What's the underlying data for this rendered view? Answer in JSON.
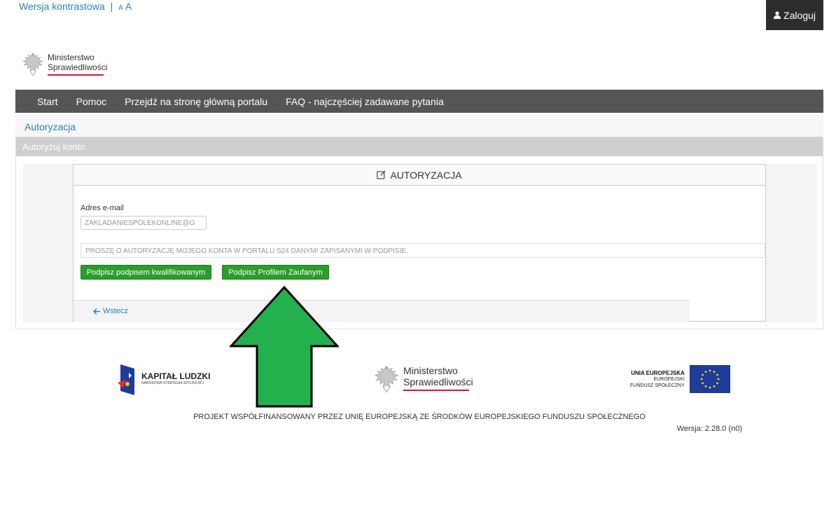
{
  "topbar": {
    "contrast_link": "Wersja kontrastowa",
    "separator": "|",
    "font_small": "A",
    "font_big": "A"
  },
  "header": {
    "login_label": "Zaloguj",
    "login_icon": "user-icon",
    "logo_line1": "Ministerstwo",
    "logo_line2": "Sprawiedliwości"
  },
  "nav": {
    "items": [
      {
        "label": "Start"
      },
      {
        "label": "Pomoc"
      },
      {
        "label": "Przejdź na stronę główną portalu"
      },
      {
        "label": "FAQ - najczęściej zadawane pytania"
      }
    ]
  },
  "breadcrumb": {
    "current": "Autoryzacja"
  },
  "panel": {
    "title": "Autoryzuj konto"
  },
  "auth": {
    "heading": "AUTORYZACJA",
    "heading_icon": "edit-icon",
    "email_label": "Adres e-mail",
    "email_value": "ZAKLADANIESPOLEKONLINE@G",
    "statement": "PROSZĘ O AUTORYZACJĘ MOJEGO KONTA W PORTALU S24 DANYMI ZAPISANYMI W PODPISIE.",
    "btn_qualified": "Podpisz podpisem kwalifikowanym",
    "btn_trusted": "Podpisz Profilem Zaufanym",
    "back_label": "Wstecz",
    "back_icon": "arrow-left-icon"
  },
  "annotation": {
    "arrow_color": "#22b14c"
  },
  "footer": {
    "kl_title": "KAPITAŁ LUDZKI",
    "kl_sub": "NARODOWA STRATEGIA SPÓJNOŚCI",
    "ms_line1": "Ministerstwo",
    "ms_line2": "Sprawiedliwości",
    "eu_title": "UNIA EUROPEJSKA",
    "eu_sub1": "EUROPEJSKI",
    "eu_sub2": "FUNDUSZ SPOŁECZNY",
    "project": "PROJEKT WSPÓŁFINANSOWANY PRZEZ UNIĘ EUROPEJSKĄ ZE ŚRODKÓW EUROPEJSKIEGO FUNDUSZU SPOŁECZNEGO",
    "version": "Wersja: 2.28.0 (n0)"
  },
  "colors": {
    "nav_bg": "#555555",
    "link": "#2a7fc1",
    "button_green": "#2a9d2a",
    "accent_red": "#dc143c"
  }
}
